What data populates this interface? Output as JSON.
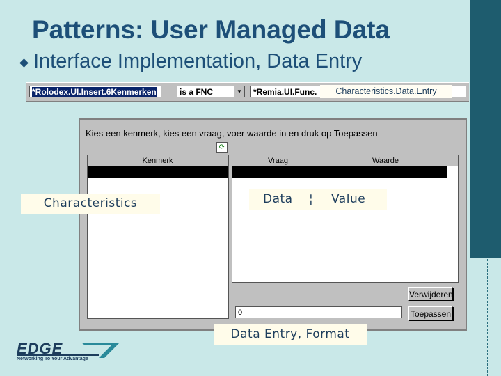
{
  "slide": {
    "title": "Patterns: User Managed Data",
    "subtitle": "Interface Implementation, Data Entry"
  },
  "toolbar": {
    "field1": "*Rolodex.UI.Insert.6Kenmerken",
    "combo": "is a FNC",
    "combo_arrow": "▼",
    "field3": "*Remia.UI.Func."
  },
  "callouts": {
    "toolbar": "Characteristics.Data.Entry",
    "characteristics": "Characteristics",
    "data": "Data",
    "separator": "¦",
    "value": "Value",
    "entry_format": "Data Entry, Format"
  },
  "dialog": {
    "instruction": "Kies een kenmerk, kies een vraag, voer waarde in en druk op Toepassen",
    "refresh_glyph": "⟳",
    "col_kenmerk": "Kenmerk",
    "col_vraag": "Vraag",
    "col_waarde": "Waarde",
    "value_input": "0",
    "btn_delete": "Verwijderen",
    "btn_apply": "Toepassen"
  },
  "logo": {
    "text": "EDGE",
    "tagline": "Networking To Your Advantage"
  },
  "colors": {
    "background": "#c9e8e8",
    "title": "#1d4f78",
    "rightbar": "#1e5c6e",
    "dialog": "#c0c0c0"
  }
}
